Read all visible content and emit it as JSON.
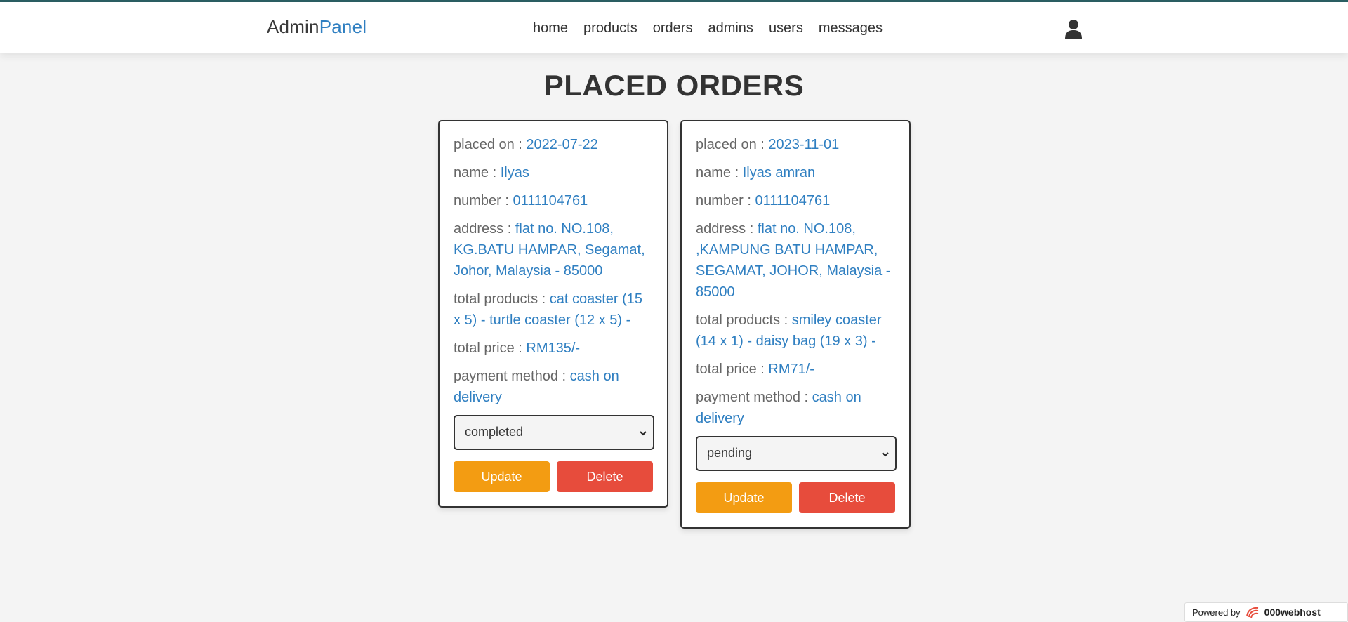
{
  "header": {
    "logo_main": "Admin",
    "logo_accent": "Panel",
    "nav": [
      "home",
      "products",
      "orders",
      "admins",
      "users",
      "messages"
    ],
    "user_icon": "user-icon"
  },
  "page": {
    "title": "PLACED ORDERS"
  },
  "labels": {
    "placed_on": "placed on : ",
    "name": "name : ",
    "number": "number : ",
    "address": "address : ",
    "total_products": "total products : ",
    "total_price": "total price : ",
    "payment_method": "payment method : ",
    "update": "Update",
    "delete": "Delete"
  },
  "orders": [
    {
      "placed_on": "2022-07-22",
      "name": "Ilyas",
      "number": "0111104761",
      "address": "flat no. NO.108, KG.BATU HAMPAR, Segamat, Johor, Malaysia - 85000",
      "total_products": "cat coaster (15 x 5) - turtle coaster (12 x 5) -",
      "total_price": "RM135/-",
      "payment_method": "cash on delivery",
      "status": "completed"
    },
    {
      "placed_on": "2023-11-01",
      "name": "Ilyas amran",
      "number": "0111104761",
      "address": "flat no. NO.108, ,KAMPUNG BATU HAMPAR, SEGAMAT, JOHOR, Malaysia - 85000",
      "total_products": "smiley coaster (14 x 1) - daisy bag (19 x 3) -",
      "total_price": "RM71/-",
      "payment_method": "cash on delivery",
      "status": "pending"
    }
  ],
  "footer": {
    "powered_by": "Powered by",
    "brand": "000webhost"
  },
  "colors": {
    "accent": "#2f7fc1",
    "update": "#f39c12",
    "delete": "#e74c3c"
  }
}
